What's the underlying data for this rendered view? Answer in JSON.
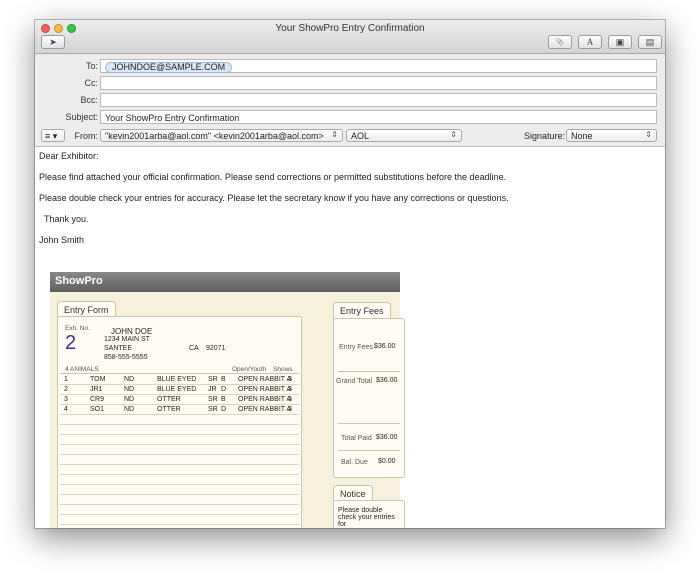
{
  "window": {
    "title": "Your ShowPro Entry Confirmation"
  },
  "toolbar": {
    "send_glyph": "➤",
    "attach_glyph": "📎",
    "font_glyph": "A",
    "photo_glyph": "▣",
    "format_glyph": "▤"
  },
  "headers": {
    "to_label": "To:",
    "to_value": "JOHNDOE@SAMPLE.COM",
    "cc_label": "Cc:",
    "bcc_label": "Bcc:",
    "subject_label": "Subject:",
    "subject_value": "Your ShowPro Entry Confirmation",
    "menu_glyph": "≡ ▾",
    "from_label": "From:",
    "from_value": "\"kevin2001arba@aol.com\" <kevin2001arba@aol.com>",
    "account_value": "AOL",
    "signature_label": "Signature:",
    "signature_value": "None"
  },
  "message": {
    "line1": "Dear Exhibitor:",
    "line2": "Please find attached your official confirmation. Please send corrections or permitted substitutions before the deadline.",
    "line3": "Please double check your entries for accuracy. Please let the secretary know if you have any corrections or questions.",
    "line4": "Thank you.",
    "line5": "John Smith"
  },
  "attachment": {
    "brand": "ShowPro",
    "entry_tab": "Entry Form",
    "exh_label": "Exh. No.",
    "exh_no": "2",
    "name": "JOHN DOE",
    "street": "1234 MAIN ST",
    "city": "SANTEE",
    "state": "CA",
    "zip": "92071",
    "phone": "858-555-5555",
    "animals_label": "4 ANIMALS",
    "open_youth_label": "Open/Youth",
    "shows_label": "Shows",
    "rows": [
      {
        "n": "1",
        "ear": "TOM",
        "breed": "ND",
        "variety": "BLUE EYED",
        "cls": "SR",
        "sex": "B",
        "div": "OPEN RABBIT A",
        "shows": "3"
      },
      {
        "n": "2",
        "ear": "JR1",
        "breed": "ND",
        "variety": "BLUE EYED",
        "cls": "JR",
        "sex": "D",
        "div": "OPEN RABBIT A",
        "shows": "3"
      },
      {
        "n": "3",
        "ear": "CR9",
        "breed": "ND",
        "variety": "OTTER",
        "cls": "SR",
        "sex": "B",
        "div": "OPEN RABBIT A",
        "shows": "3"
      },
      {
        "n": "4",
        "ear": "SO1",
        "breed": "ND",
        "variety": "OTTER",
        "cls": "SR",
        "sex": "D",
        "div": "OPEN RABBIT A",
        "shows": "3"
      }
    ],
    "fees_tab": "Entry Fees",
    "entry_fees_label": "Entry Fees",
    "entry_fees": "$36.00",
    "grand_total_label": "Grand Total",
    "grand_total": "$36.00",
    "total_paid_label": "Total Paid",
    "total_paid": "$36.00",
    "bal_due_label": "Bal. Due",
    "bal_due": "$0.00",
    "notice_tab": "Notice",
    "notice_text": "Please double check your entries for"
  }
}
